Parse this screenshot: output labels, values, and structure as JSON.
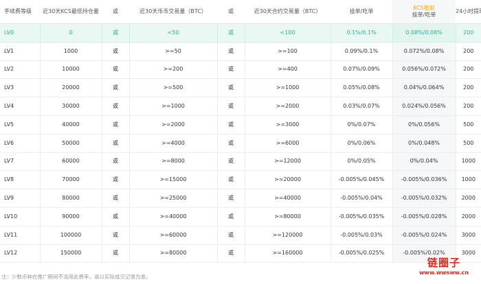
{
  "table": {
    "headers": [
      "手续费等级",
      "近30天KCS最低持仓量",
      "或",
      "近30天币币交易量（BTC）",
      "或",
      "近30天合约交易量（BTC）",
      "挂单/吃单",
      "KCS抵扣",
      "挂单/吃单",
      "24小时提现额度"
    ],
    "rows": [
      [
        "LV0",
        "0",
        "或",
        "<50",
        "或",
        "<100",
        "0.1%/0.1%",
        "0.08%/0.08%",
        "200"
      ],
      [
        "LV1",
        "1000",
        "或",
        ">=50",
        "或",
        ">=100",
        "0.09%/0.1%",
        "0.072%/0.08%",
        "200"
      ],
      [
        "LV2",
        "10000",
        "或",
        ">=200",
        "或",
        ">=400",
        "0.07%/0.09%",
        "0.056%/0.072%",
        "200"
      ],
      [
        "LV3",
        "20000",
        "或",
        ">=500",
        "或",
        ">=1000",
        "0.05%/0.08%",
        "0.04%/0.064%",
        "200"
      ],
      [
        "LV4",
        "30000",
        "或",
        ">=1000",
        "或",
        ">=2000",
        "0.03%/0.07%",
        "0.024%/0.056%",
        "200"
      ],
      [
        "LV5",
        "40000",
        "或",
        ">=2000",
        "或",
        ">=3000",
        "0%/0.07%",
        "0%/0.056%",
        "500"
      ],
      [
        "LV6",
        "50000",
        "或",
        ">=4000",
        "或",
        ">=6000",
        "0%/0.06%",
        "0%/0.048%",
        "500"
      ],
      [
        "LV7",
        "60000",
        "或",
        ">=8000",
        "或",
        ">=12000",
        "0%/0.05%",
        "0%/0.04%",
        "1000"
      ],
      [
        "LV8",
        "70000",
        "或",
        ">=15000",
        "或",
        ">=20000",
        "-0.005%/0.045%",
        "-0.005%/0.036%",
        "1000"
      ],
      [
        "LV9",
        "80000",
        "或",
        ">=25000",
        "或",
        ">=40000",
        "-0.005%/0.04%",
        "-0.005%/0.032%",
        "2000"
      ],
      [
        "LV10",
        "90000",
        "或",
        ">=40000",
        "或",
        ">=80000",
        "-0.005%/0.035%",
        "-0.005%/0.028%",
        "2000"
      ],
      [
        "LV11",
        "100000",
        "或",
        ">=60000",
        "或",
        ">=120000",
        "-0.005%/0.03%",
        "-0.005%/0.024%",
        "3000"
      ],
      [
        "LV12",
        "150000",
        "或",
        ">=80000",
        "或",
        ">=160000",
        "-0.005%/0.025%",
        "-0.005%/0.02%",
        "3000"
      ]
    ]
  },
  "note": "注：少数币种在推广期间不适用此费率，请以实际成交记录为准。",
  "watermark": {
    "title": "链圈子",
    "url": "www.wwsww.cn"
  },
  "colors": {
    "highlight_text": "#22b48e",
    "highlight_bg": "#eaf8f3",
    "kcs_label": "#f5a623",
    "watermark": "#e4261b"
  }
}
